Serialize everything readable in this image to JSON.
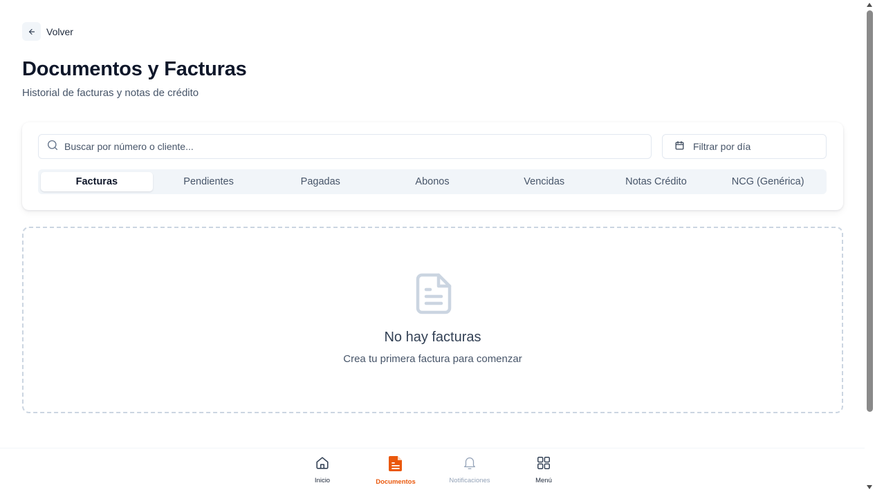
{
  "back": {
    "label": "Volver"
  },
  "header": {
    "title": "Documentos y Facturas",
    "subtitle": "Historial de facturas y notas de crédito"
  },
  "filters": {
    "search_placeholder": "Buscar por número o cliente...",
    "date_label": "Filtrar por día"
  },
  "tabs": [
    {
      "label": "Facturas",
      "active": true
    },
    {
      "label": "Pendientes",
      "active": false
    },
    {
      "label": "Pagadas",
      "active": false
    },
    {
      "label": "Abonos",
      "active": false
    },
    {
      "label": "Vencidas",
      "active": false
    },
    {
      "label": "Notas Crédito",
      "active": false
    },
    {
      "label": "NCG (Genérica)",
      "active": false
    }
  ],
  "empty_state": {
    "icon": "document-icon",
    "title": "No hay facturas",
    "text": "Crea tu primera factura para comenzar"
  },
  "bottom_nav": [
    {
      "label": "Inicio",
      "icon": "home-icon",
      "state": "normal"
    },
    {
      "label": "Documentos",
      "icon": "document-icon",
      "state": "active"
    },
    {
      "label": "Notificaciones",
      "icon": "bell-icon",
      "state": "disabled"
    },
    {
      "label": "Menú",
      "icon": "grid-icon",
      "state": "normal"
    }
  ],
  "colors": {
    "accent": "#ea580c",
    "text_primary": "#0f172a",
    "text_muted": "#475569",
    "border": "#e2e8f0",
    "empty_border": "#cbd5e1"
  }
}
